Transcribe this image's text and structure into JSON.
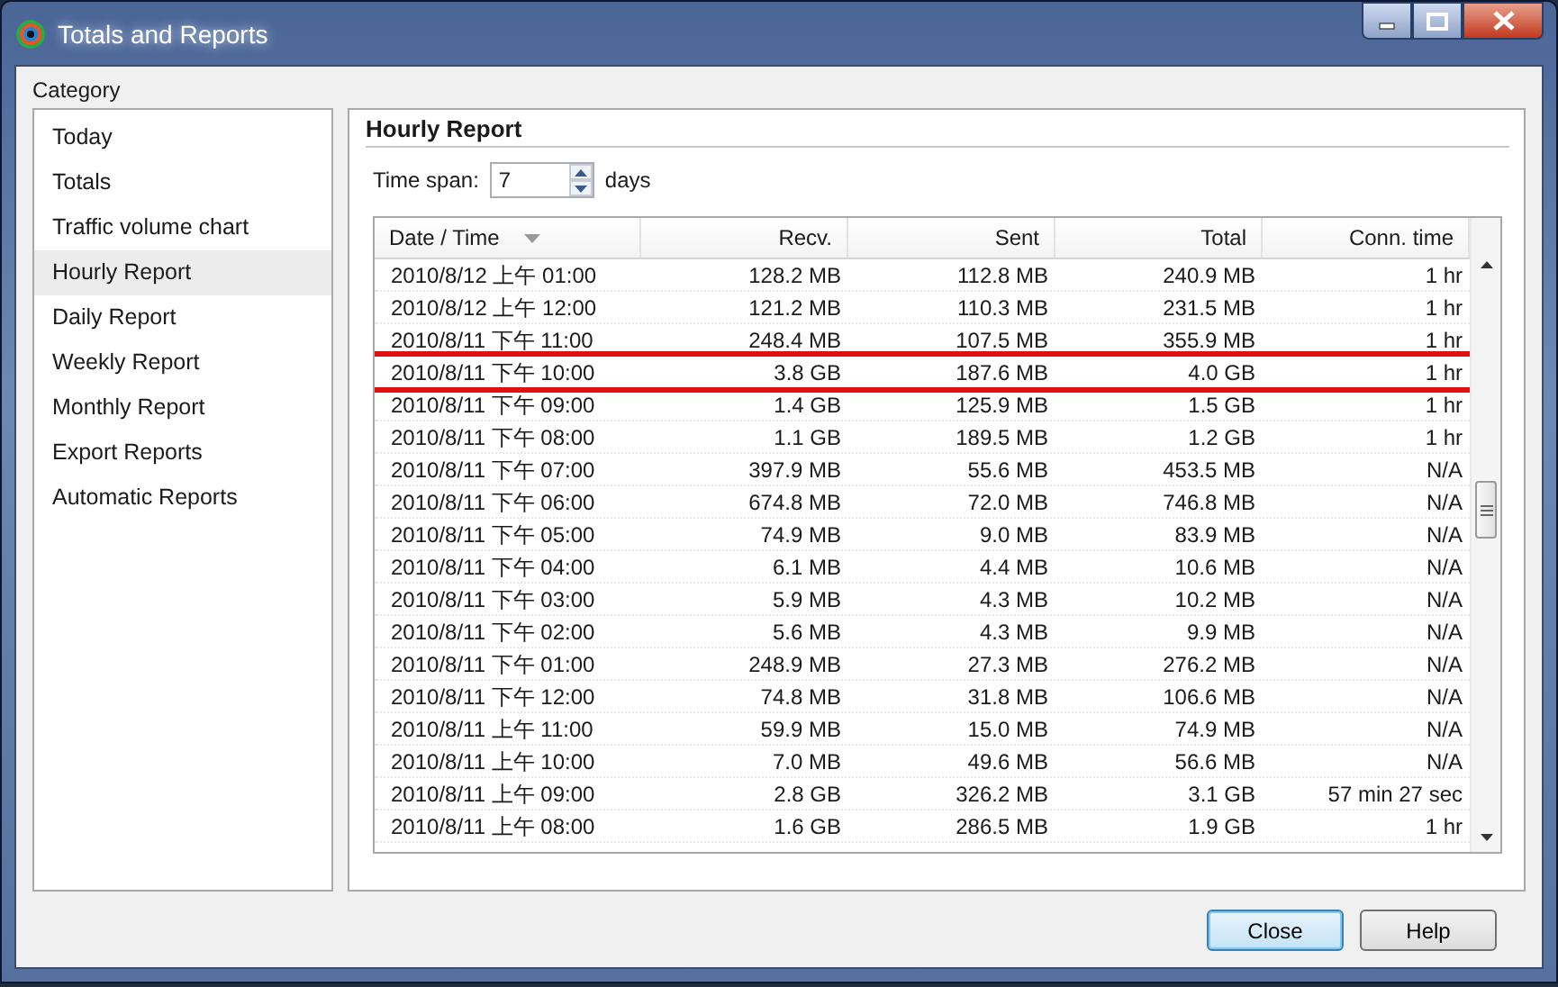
{
  "window": {
    "title": "Totals and Reports"
  },
  "category": {
    "label": "Category",
    "items": [
      {
        "label": "Today",
        "selected": false
      },
      {
        "label": "Totals",
        "selected": false
      },
      {
        "label": "Traffic volume chart",
        "selected": false
      },
      {
        "label": "Hourly Report",
        "selected": true
      },
      {
        "label": "Daily Report",
        "selected": false
      },
      {
        "label": "Weekly Report",
        "selected": false
      },
      {
        "label": "Monthly Report",
        "selected": false
      },
      {
        "label": "Export Reports",
        "selected": false
      },
      {
        "label": "Automatic Reports",
        "selected": false
      }
    ]
  },
  "report": {
    "title": "Hourly Report",
    "time_span": {
      "label": "Time span:",
      "value": "7",
      "unit": "days"
    },
    "table": {
      "columns": [
        "Date / Time",
        "Recv.",
        "Sent",
        "Total",
        "Conn. time"
      ],
      "rows": [
        {
          "cells": [
            "2010/8/12 上午 01:00",
            "128.2 MB",
            "112.8 MB",
            "240.9 MB",
            "1 hr"
          ],
          "highlighted": false
        },
        {
          "cells": [
            "2010/8/12 上午 12:00",
            "121.2 MB",
            "110.3 MB",
            "231.5 MB",
            "1 hr"
          ],
          "highlighted": false
        },
        {
          "cells": [
            "2010/8/11 下午 11:00",
            "248.4 MB",
            "107.5 MB",
            "355.9 MB",
            "1 hr"
          ],
          "highlighted": false
        },
        {
          "cells": [
            "2010/8/11 下午 10:00",
            "3.8 GB",
            "187.6 MB",
            "4.0 GB",
            "1 hr"
          ],
          "highlighted": true
        },
        {
          "cells": [
            "2010/8/11 下午 09:00",
            "1.4 GB",
            "125.9 MB",
            "1.5 GB",
            "1 hr"
          ],
          "highlighted": false
        },
        {
          "cells": [
            "2010/8/11 下午 08:00",
            "1.1 GB",
            "189.5 MB",
            "1.2 GB",
            "1 hr"
          ],
          "highlighted": false
        },
        {
          "cells": [
            "2010/8/11 下午 07:00",
            "397.9 MB",
            "55.6 MB",
            "453.5 MB",
            "N/A"
          ],
          "highlighted": false
        },
        {
          "cells": [
            "2010/8/11 下午 06:00",
            "674.8 MB",
            "72.0 MB",
            "746.8 MB",
            "N/A"
          ],
          "highlighted": false
        },
        {
          "cells": [
            "2010/8/11 下午 05:00",
            "74.9 MB",
            "9.0 MB",
            "83.9 MB",
            "N/A"
          ],
          "highlighted": false
        },
        {
          "cells": [
            "2010/8/11 下午 04:00",
            "6.1 MB",
            "4.4 MB",
            "10.6 MB",
            "N/A"
          ],
          "highlighted": false
        },
        {
          "cells": [
            "2010/8/11 下午 03:00",
            "5.9 MB",
            "4.3 MB",
            "10.2 MB",
            "N/A"
          ],
          "highlighted": false
        },
        {
          "cells": [
            "2010/8/11 下午 02:00",
            "5.6 MB",
            "4.3 MB",
            "9.9 MB",
            "N/A"
          ],
          "highlighted": false
        },
        {
          "cells": [
            "2010/8/11 下午 01:00",
            "248.9 MB",
            "27.3 MB",
            "276.2 MB",
            "N/A"
          ],
          "highlighted": false
        },
        {
          "cells": [
            "2010/8/11 下午 12:00",
            "74.8 MB",
            "31.8 MB",
            "106.6 MB",
            "N/A"
          ],
          "highlighted": false
        },
        {
          "cells": [
            "2010/8/11 上午 11:00",
            "59.9 MB",
            "15.0 MB",
            "74.9 MB",
            "N/A"
          ],
          "highlighted": false
        },
        {
          "cells": [
            "2010/8/11 上午 10:00",
            "7.0 MB",
            "49.6 MB",
            "56.6 MB",
            "N/A"
          ],
          "highlighted": false
        },
        {
          "cells": [
            "2010/8/11 上午 09:00",
            "2.8 GB",
            "326.2 MB",
            "3.1 GB",
            "57 min 27 sec"
          ],
          "highlighted": false
        },
        {
          "cells": [
            "2010/8/11 上午 08:00",
            "1.6 GB",
            "286.5 MB",
            "1.9 GB",
            "1 hr"
          ],
          "highlighted": false
        }
      ]
    }
  },
  "buttons": [
    {
      "label": "Close",
      "default": true
    },
    {
      "label": "Help",
      "default": false
    }
  ]
}
